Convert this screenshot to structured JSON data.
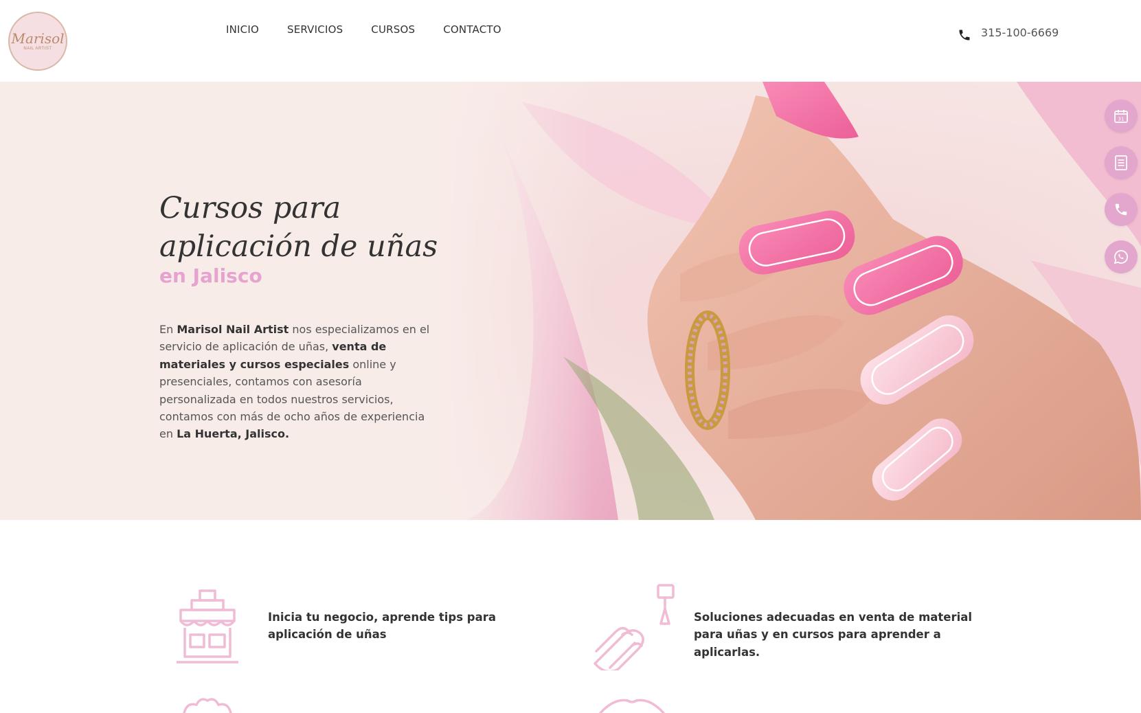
{
  "brand": {
    "logo_script": "Marisol",
    "logo_sub": "NAIL ARTIST",
    "accent": "#e6a3cf",
    "side_button_color": "#e3a6cd",
    "icon_color": "#f0bcd5"
  },
  "nav": {
    "items": [
      "INICIO",
      "SERVICIOS",
      "CURSOS",
      "CONTACTO"
    ]
  },
  "header": {
    "phone_icon": "phone-icon",
    "phone_number": "315-100-6669"
  },
  "hero": {
    "title": "Cursos para\n aplicación de uñas",
    "subtitle": "en Jalisco",
    "text_parts": {
      "p1": "En ",
      "b1": "Marisol Nail Artist",
      "p2": " nos especializamos en el servicio de aplicación de uñas, ",
      "b2": "venta de materiales y cursos especiales",
      "p3": " online y presenciales, contamos con asesoría personalizada en todos nuestros servicios, contamos con más de ocho años de experiencia en ",
      "b3": "La Huerta, Jalisco."
    }
  },
  "side_buttons": [
    "calendar-icon",
    "document-icon",
    "phone-icon",
    "whatsapp-icon"
  ],
  "features": [
    {
      "icon": "shop-icon",
      "text": "Inicia tu negocio, aprende tips para aplicación de uñas"
    },
    {
      "icon": "nail-polish-icon",
      "text": "Soluciones adecuadas en venta de material para uñas y en cursos para aprender a aplicarlas."
    }
  ]
}
